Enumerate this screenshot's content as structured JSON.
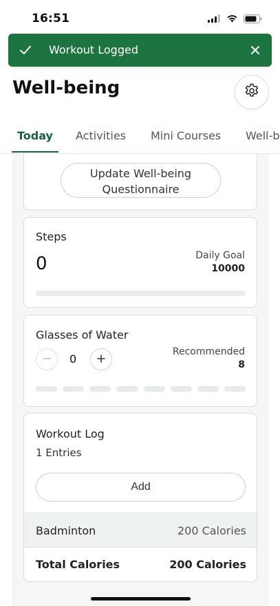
{
  "status_bar": {
    "time": "16:51",
    "icons": [
      "cellular-signal-icon",
      "wifi-icon",
      "battery-icon"
    ]
  },
  "toast": {
    "message": "Workout Logged",
    "icon": "checkmark-icon",
    "close_icon": "close-icon",
    "background": "#1d7440"
  },
  "header": {
    "title": "Well-being",
    "settings_icon": "gear-icon"
  },
  "tabs": [
    {
      "label": "Today",
      "active": true
    },
    {
      "label": "Activities",
      "active": false
    },
    {
      "label": "Mini Courses",
      "active": false
    },
    {
      "label": "Well-b",
      "active": false
    }
  ],
  "accent_color": "#1a5e44",
  "questionnaire": {
    "button_label": "Update Well-being Questionnaire"
  },
  "steps": {
    "title": "Steps",
    "value": "0",
    "goal_label": "Daily Goal",
    "goal_value": "10000",
    "progress": 0
  },
  "water": {
    "title": "Glasses of Water",
    "count": "0",
    "recommended_label": "Recommended",
    "recommended_value": "8",
    "filled_segments": 0,
    "total_segments": 8
  },
  "workout_log": {
    "title": "Workout Log",
    "entries_text": "1 Entries",
    "add_label": "Add",
    "rows": [
      {
        "name": "Badminton",
        "calories": "200 Calories"
      }
    ],
    "total_label": "Total Calories",
    "total_value": "200 Calories"
  }
}
